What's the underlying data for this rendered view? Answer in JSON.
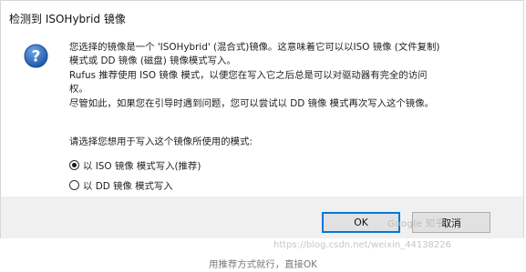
{
  "dialog": {
    "title": "检测到 ISOHybrid 镜像",
    "icon": "question-icon",
    "message_lines": [
      "您选择的镜像是一个 'ISOHybrid' (混合式)镜像。这意味着它可以以ISO 镜像 (文件复制)",
      "模式或 DD 镜像 (磁盘) 镜像模式写入。",
      "Rufus 推荐使用 ISO 镜像 模式，以便您在写入它之后总是可以对驱动器有完全的访问",
      "权。",
      "尽管如此，如果您在引导时遇到问题，您可以尝试以 DD 镜像 模式再次写入这个镜像。"
    ],
    "prompt": "请选择您想用于写入这个镜像所使用的模式:",
    "options": [
      {
        "label": "以 ISO 镜像 模式写入(推荐)",
        "selected": true
      },
      {
        "label": "以 DD 镜像 模式写入",
        "selected": false
      }
    ],
    "ok_label": "OK",
    "cancel_label": "取消"
  },
  "watermark": {
    "line1": "Google 知乎",
    "line2": "https://blog.csdn.net/weixin_44138226"
  },
  "caption": "用推荐方式就行，直接OK",
  "colors": {
    "accent": "#0078d7",
    "icon_blue": "#2c68b8",
    "footer_bg": "#f0f0f0",
    "button_bg": "#e1e1e1"
  }
}
